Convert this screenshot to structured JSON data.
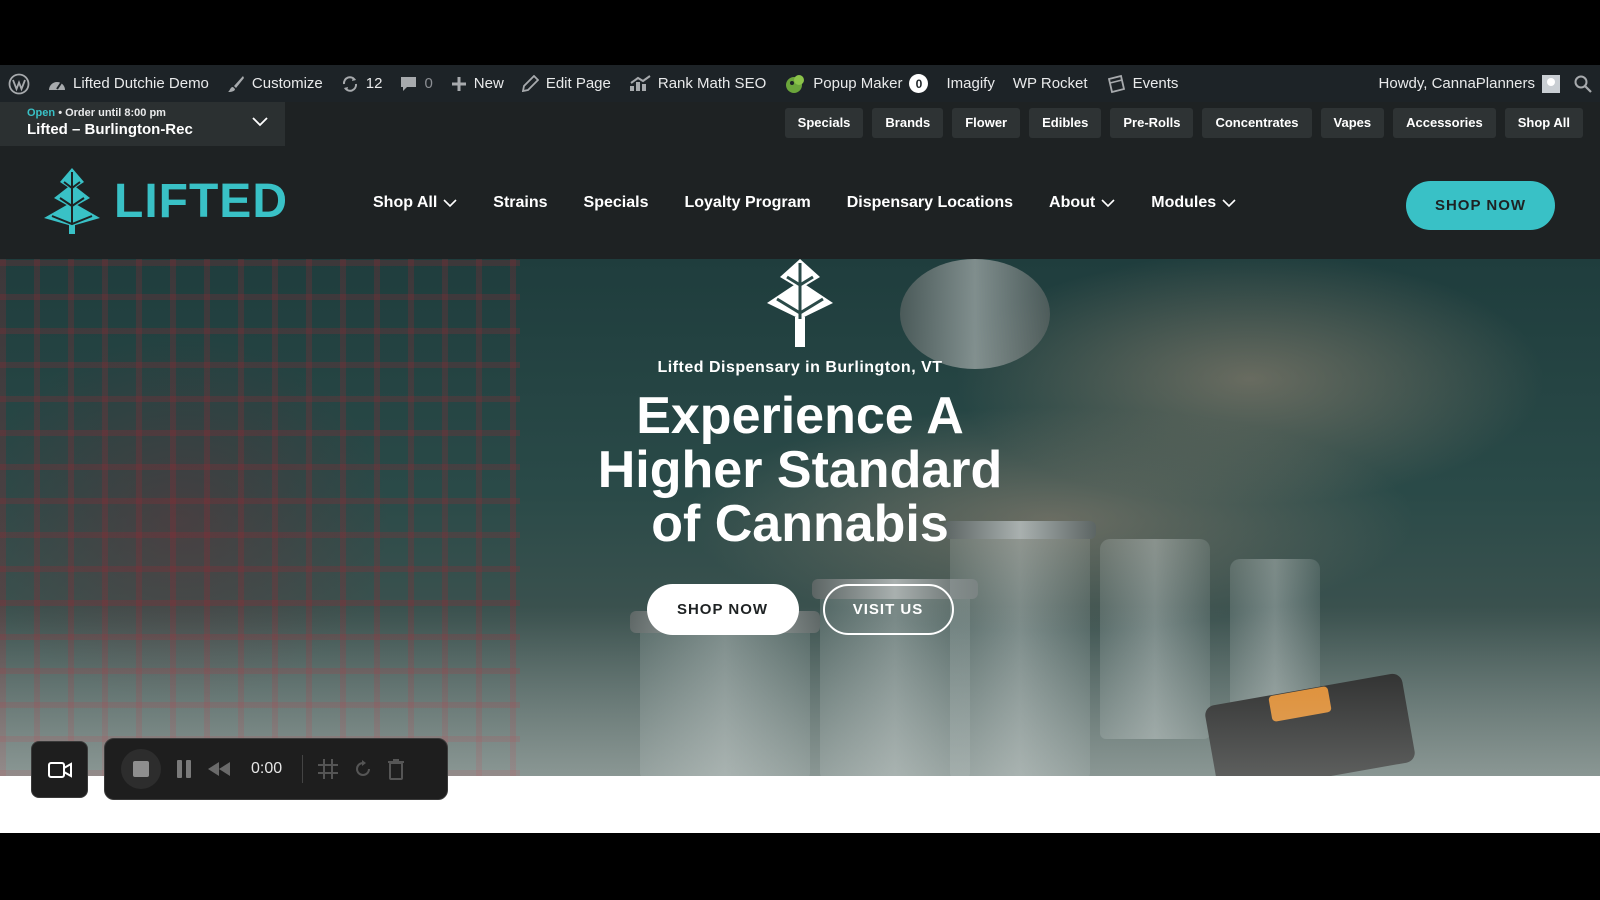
{
  "adminbar": {
    "site_name": "Lifted Dutchie Demo",
    "customize": "Customize",
    "updates_count": "12",
    "comments_count": "0",
    "new": "New",
    "edit_page": "Edit Page",
    "rank_math": "Rank Math SEO",
    "popup_maker": "Popup Maker",
    "popup_count": "0",
    "imagify": "Imagify",
    "wp_rocket": "WP Rocket",
    "events": "Events",
    "howdy": "Howdy, CannaPlanners"
  },
  "store": {
    "status_open": "Open",
    "status_rest": "• Order until 8:00 pm",
    "name": "Lifted – Burlington-Rec"
  },
  "categories": [
    "Specials",
    "Brands",
    "Flower",
    "Edibles",
    "Pre-Rolls",
    "Concentrates",
    "Vapes",
    "Accessories",
    "Shop All"
  ],
  "logo": {
    "text": "LIFTED"
  },
  "nav": {
    "shop_all": "Shop All",
    "strains": "Strains",
    "specials": "Specials",
    "loyalty": "Loyalty Program",
    "locations": "Dispensary Locations",
    "about": "About",
    "modules": "Modules",
    "shop_now": "SHOP NOW"
  },
  "hero": {
    "subtitle": "Lifted Dispensary in Burlington, VT",
    "title_line1": "Experience A",
    "title_line2": "Higher Standard",
    "title_line3": "of Cannabis",
    "btn_shop": "SHOP NOW",
    "btn_visit": "VISIT US"
  },
  "recorder": {
    "time": "0:00"
  },
  "colors": {
    "accent": "#39c1c6",
    "header_bg": "#1e2223",
    "adminbar_bg": "#1d2327"
  }
}
